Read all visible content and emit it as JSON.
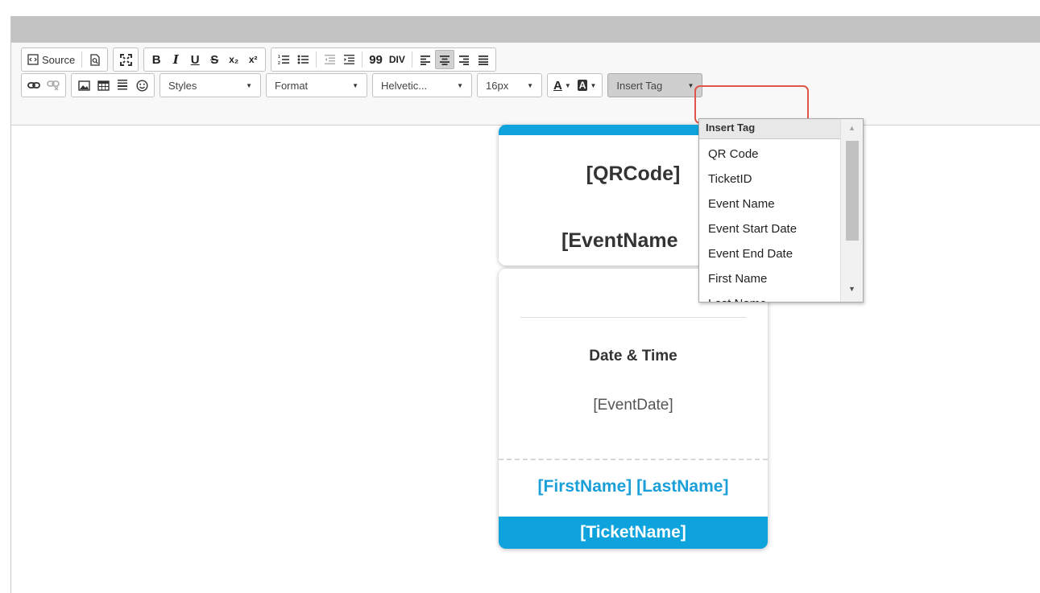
{
  "toolbar": {
    "row1": {
      "source": "Source",
      "bold": "B",
      "italic": "I",
      "underline": "U",
      "strike": "S",
      "subscript": "x₂",
      "superscript": "x²",
      "blockquote": "99",
      "creatediv": "DIV"
    },
    "row2": {
      "styles": "Styles",
      "format": "Format",
      "font": "Helvetic...",
      "size": "16px",
      "text_color": "A",
      "bg_color": "A",
      "insert_tag": "Insert Tag"
    }
  },
  "ticket": {
    "qrcode": "[QRCode]",
    "event_name": "[EventName",
    "date_time_label": "Date & Time",
    "event_date": "[EventDate]",
    "attendee_name": "[FirstName] [LastName]",
    "ticket_name": "[TicketName]"
  },
  "dropdown": {
    "header": "Insert Tag",
    "items": [
      "QR Code",
      "TicketID",
      "Event Name",
      "Event Start Date",
      "Event End Date",
      "First Name",
      "Last Name"
    ]
  },
  "colors": {
    "accent": "#0ea3dc",
    "highlight": "#e05548"
  }
}
